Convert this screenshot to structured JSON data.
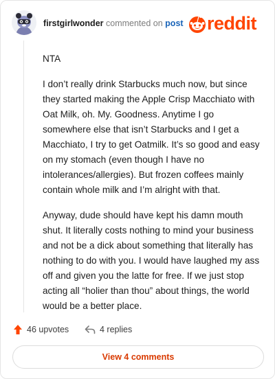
{
  "header": {
    "username": "firstgirlwonder",
    "commented_on": "commented on",
    "post_link": "post",
    "brand": "reddit"
  },
  "comment": {
    "paragraphs": [
      "NTA",
      "I don’t really drink Starbucks much now, but since they started making the Apple Crisp Macchiato with Oat Milk, oh. My. Goodness. Anytime I go somewhere else that isn’t Starbucks and I get a Macchiato, I try to get Oatmilk. It’s so good and easy on my stomach (even though I have no intolerances/allergies). But frozen coffees mainly contain whole milk and I’m alright with that.",
      "Anyway, dude should have kept his damn mouth shut. It literally costs nothing to mind your business and not be a dick about something that literally has nothing to do with you. I would have laughed my ass off and given you the latte for free. If we just stop acting all “holier than thou” about things, the world would be a better place."
    ]
  },
  "actions": {
    "upvotes_label": "46 upvotes",
    "replies_label": "4 replies"
  },
  "footer": {
    "view_comments_label": "View 4 comments"
  },
  "colors": {
    "brand": "#ff4500",
    "link": "#1a64b8",
    "cta_text": "#d93a00"
  },
  "icons": [
    "avatar-icon",
    "reddit-logo-icon",
    "upvote-arrow-icon",
    "reply-arrow-icon"
  ]
}
